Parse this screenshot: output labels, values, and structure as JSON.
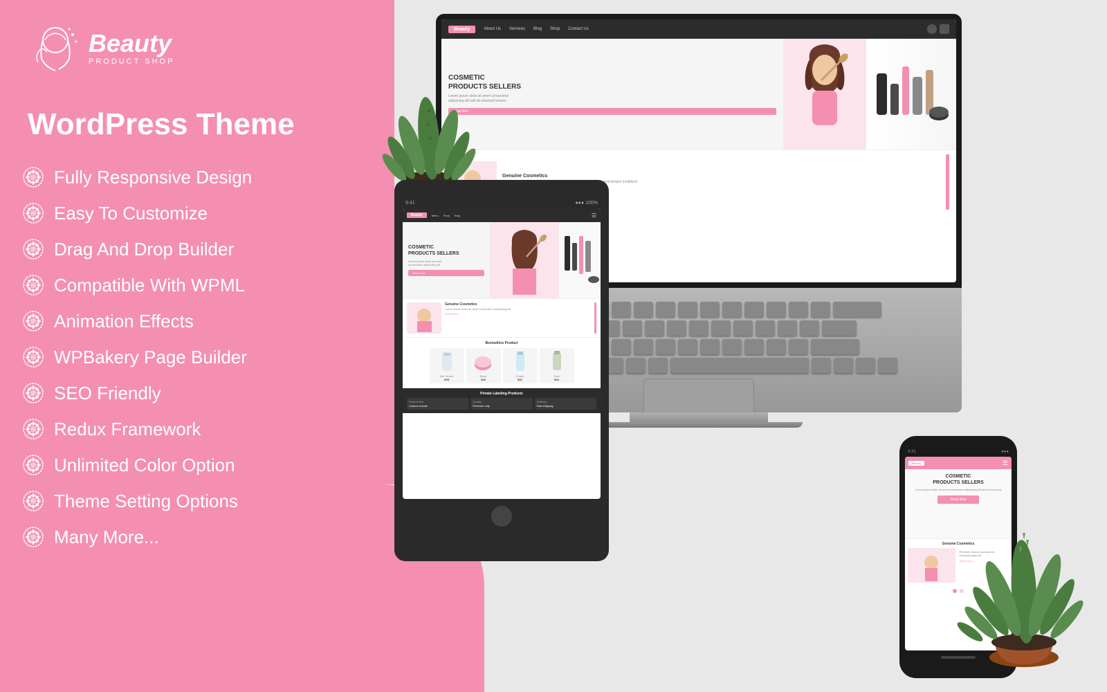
{
  "brand": {
    "name": "Beauty",
    "subtext": "PRODUCT SHOP",
    "tagline": "WordPress Theme"
  },
  "features": [
    "Fully Responsive Design",
    "Easy To Customize",
    "Drag And Drop Builder",
    "Compatible With WPML",
    "Animation Effects",
    "WPBakery Page Builder",
    "SEO Friendly",
    "Redux Framework",
    "Unlimited Color Option",
    "Theme Setting Options",
    "Many More..."
  ],
  "preview": {
    "hero_title": "COSMETIC\nPRODUCTS SELLERS",
    "shop_btn": "Shop Now",
    "section_title": "Genuine Cosmetics",
    "bestsellers_title": "Bestsellers Product",
    "private_label_title": "Private Labeling Products"
  },
  "colors": {
    "primary_pink": "#f48fb1",
    "dark": "#2c2c2c",
    "light_bg": "#e8e8e8"
  }
}
